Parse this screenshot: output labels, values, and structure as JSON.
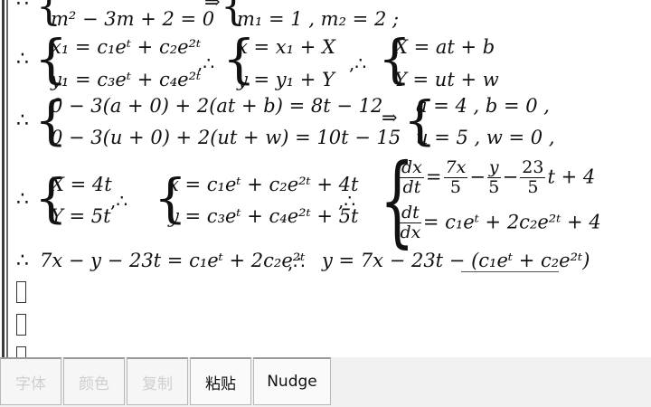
{
  "editor": {
    "row0": {
      "eq_left": "m² − 3m + 2 = 0",
      "implies": "⇒",
      "eq_right": "m₁ = 1 , m₂ = 2 ;"
    },
    "row1": {
      "therefore": "∴",
      "sys1_line1": "x₁ = c₁eᵗ + c₂e²ᵗ",
      "sys1_line2": "y₁ = c₃eᵗ + c₄e²ᵗ",
      "sep1": ",∴",
      "sys2_line1": "x = x₁ + X",
      "sys2_line2": "y = y₁ + Y",
      "sep2": ",∴",
      "sys3_line1": "X = at + b",
      "sys3_line2": "Y = ut + w"
    },
    "row2": {
      "therefore": "∴",
      "sys_line1": "0 − 3(a + 0) + 2(at + b) = 8t − 12",
      "sys_line2": "0 − 3(u + 0) + 2(ut + w) = 10t − 15",
      "implies": "⇒",
      "res_line1": "a = 4 , b = 0 ,",
      "res_line2": "u = 5 , w = 0 ,"
    },
    "row3": {
      "therefore": "∴",
      "sys1_line1": "X = 4t",
      "sys1_line2": "Y = 5t",
      "sep1": ",∴",
      "sys2_line1": "x = c₁eᵗ + c₂e²ᵗ + 4t",
      "sys2_line2": "y = c₃eᵗ + c₄e²ᵗ + 5t",
      "sep2": ",∴",
      "frac1_num": "dx",
      "frac1_den": "dt",
      "eq1": "=",
      "frac2_num": "7x",
      "frac2_den": "5",
      "minus1": "−",
      "frac3_num": "y",
      "frac3_den": "5",
      "minus2": "−",
      "frac4_num": "23",
      "frac4_den": "5",
      "tail1": "t + 4",
      "frac5_num": "dt",
      "frac5_den": "dx",
      "tail2": "= c₁eᵗ + 2c₂e²ᵗ + 4"
    },
    "row4": {
      "therefore": "∴",
      "eq1": "7x − y − 23t = c₁eᵗ + 2c₂e²ᵗ",
      "sep": ",∴",
      "eq2": "y = 7x − 23t − (c₁eᵗ + c₂e²ᵗ)"
    }
  },
  "toolbar": {
    "font_label": "字体",
    "color_label": "颜色",
    "copy_label": "复制",
    "paste_label": "粘贴",
    "nudge_label": "Nudge"
  },
  "colors": {
    "toolbar_bg": "#f0f0f0",
    "disabled_text": "#cfcfcf",
    "enabled_text": "#111111"
  }
}
